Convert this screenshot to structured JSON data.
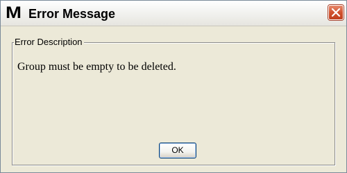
{
  "window": {
    "logo_letter": "M",
    "title": "Error Message",
    "titlebar_accent": "#d0522f"
  },
  "group": {
    "legend": "Error Description",
    "message": "Group must be empty to be deleted."
  },
  "buttons": {
    "ok_label": "OK"
  },
  "icons": {
    "close": "close-icon"
  }
}
